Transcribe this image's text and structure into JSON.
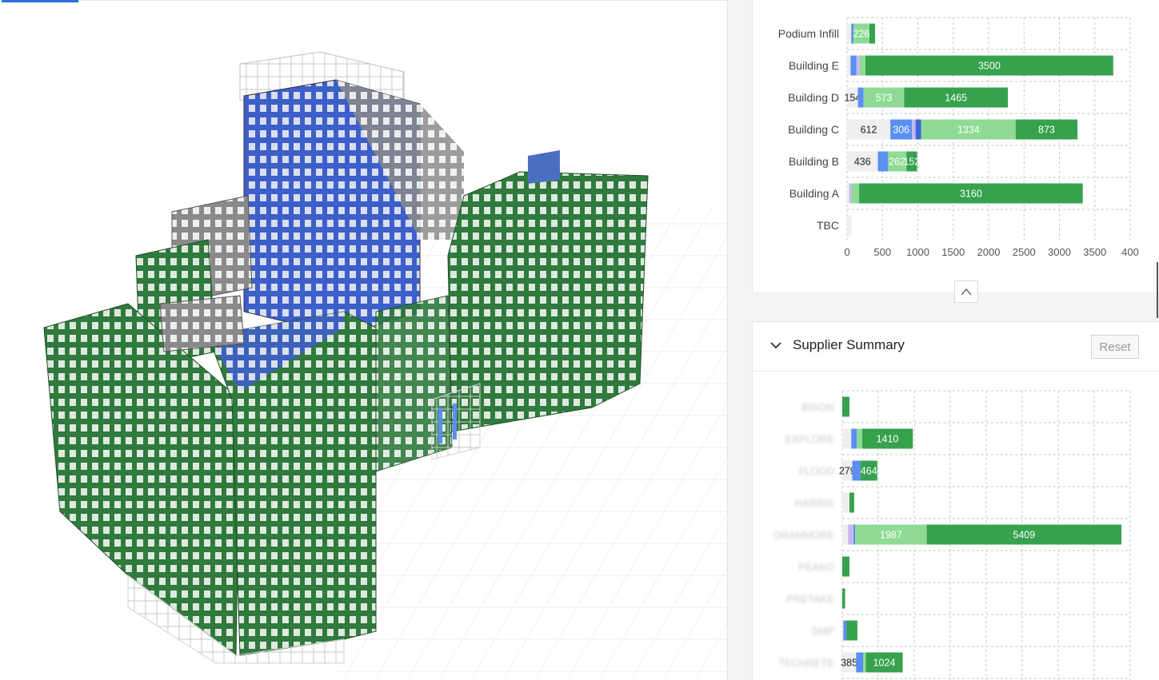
{
  "viewer": {
    "active_tab_indicator": "model-view"
  },
  "colors": {
    "gray": "#efefef",
    "blue": "#5b8ff2",
    "dark_blue": "#3f68d6",
    "lavender": "#c8b8f2",
    "light_green": "#8fdb95",
    "green": "#36a24e",
    "grid": "#c8c8c8"
  },
  "building_chart": {
    "type": "bar",
    "orientation": "horizontal",
    "stacked": true,
    "xlim": [
      0,
      4000
    ],
    "ticks": [
      "0",
      "500",
      "1000",
      "1500",
      "2000",
      "2500",
      "3000",
      "3500",
      "400"
    ],
    "categories": [
      "Podium Infill",
      "Building E",
      "Building D",
      "Building C",
      "Building B",
      "Building A",
      "TBC"
    ],
    "rows": [
      {
        "label": "Podium Infill",
        "segments": [
          {
            "color": "gray",
            "value": 60,
            "label": ""
          },
          {
            "color": "blue",
            "value": 30,
            "label": ""
          },
          {
            "color": "light_green",
            "value": 226,
            "label": "226"
          },
          {
            "color": "green",
            "value": 80,
            "label": ""
          }
        ]
      },
      {
        "label": "Building E",
        "segments": [
          {
            "color": "gray",
            "value": 50,
            "label": ""
          },
          {
            "color": "blue",
            "value": 80,
            "label": ""
          },
          {
            "color": "lavender",
            "value": 50,
            "label": ""
          },
          {
            "color": "light_green",
            "value": 80,
            "label": ""
          },
          {
            "color": "green",
            "value": 3500,
            "label": "3500"
          }
        ]
      },
      {
        "label": "Building D",
        "segments": [
          {
            "color": "gray",
            "value": 154,
            "label": "154"
          },
          {
            "color": "blue",
            "value": 80,
            "label": ""
          },
          {
            "color": "light_green",
            "value": 573,
            "label": "573"
          },
          {
            "color": "green",
            "value": 1465,
            "label": "1465"
          }
        ]
      },
      {
        "label": "Building C",
        "segments": [
          {
            "color": "gray",
            "value": 612,
            "label": "612"
          },
          {
            "color": "blue",
            "value": 306,
            "label": "306"
          },
          {
            "color": "lavender",
            "value": 50,
            "label": ""
          },
          {
            "color": "dark_blue",
            "value": 80,
            "label": ""
          },
          {
            "color": "light_green",
            "value": 1334,
            "label": "1334"
          },
          {
            "color": "green",
            "value": 873,
            "label": "873"
          }
        ]
      },
      {
        "label": "Building B",
        "segments": [
          {
            "color": "gray",
            "value": 436,
            "label": "436"
          },
          {
            "color": "blue",
            "value": 140,
            "label": ""
          },
          {
            "color": "light_green",
            "value": 262,
            "label": "262"
          },
          {
            "color": "green",
            "value": 152,
            "label": "152"
          }
        ]
      },
      {
        "label": "Building A",
        "segments": [
          {
            "color": "gray",
            "value": 30,
            "label": ""
          },
          {
            "color": "lavender",
            "value": 30,
            "label": ""
          },
          {
            "color": "light_green",
            "value": 110,
            "label": ""
          },
          {
            "color": "green",
            "value": 3160,
            "label": "3160"
          }
        ]
      },
      {
        "label": "TBC",
        "segments": [
          {
            "color": "gray",
            "value": 60,
            "label": ""
          }
        ]
      }
    ]
  },
  "supplier_summary": {
    "title": "Supplier Summary",
    "reset_label": "Reset",
    "chart": {
      "type": "bar",
      "orientation": "horizontal",
      "stacked": true,
      "xlim": [
        0,
        8000
      ],
      "categories": [
        "BISON",
        "EXPLORE",
        "FLOOD",
        "HARRIS",
        "ORANMORE",
        "PEAKO",
        "PRETAKE",
        "SMP",
        "TECHRETE"
      ],
      "rows": [
        {
          "label": "BISON",
          "segments": [
            {
              "color": "green",
              "value": 200,
              "label": ""
            }
          ]
        },
        {
          "label": "EXPLORE",
          "segments": [
            {
              "color": "gray",
              "value": 250,
              "label": ""
            },
            {
              "color": "blue",
              "value": 150,
              "label": ""
            },
            {
              "color": "light_green",
              "value": 150,
              "label": ""
            },
            {
              "color": "green",
              "value": 1410,
              "label": "1410"
            }
          ]
        },
        {
          "label": "FLOOD",
          "segments": [
            {
              "color": "gray",
              "value": 279,
              "label": "279"
            },
            {
              "color": "blue",
              "value": 230,
              "label": ""
            },
            {
              "color": "light_green",
              "value": 0,
              "label": ""
            },
            {
              "color": "green",
              "value": 464,
              "label": "464"
            }
          ]
        },
        {
          "label": "HARRIS",
          "segments": [
            {
              "color": "gray",
              "value": 200,
              "label": ""
            },
            {
              "color": "green",
              "value": 130,
              "label": ""
            }
          ]
        },
        {
          "label": "ORANMORE",
          "segments": [
            {
              "color": "gray",
              "value": 160,
              "label": ""
            },
            {
              "color": "lavender",
              "value": 150,
              "label": ""
            },
            {
              "color": "blue",
              "value": 50,
              "label": ""
            },
            {
              "color": "light_green",
              "value": 1987,
              "label": "1987"
            },
            {
              "color": "green",
              "value": 5409,
              "label": "5409"
            }
          ]
        },
        {
          "label": "PEAKO",
          "segments": [
            {
              "color": "green",
              "value": 200,
              "label": ""
            }
          ]
        },
        {
          "label": "PRETAKE",
          "segments": [
            {
              "color": "green",
              "value": 80,
              "label": ""
            }
          ]
        },
        {
          "label": "SMP",
          "segments": [
            {
              "color": "gray",
              "value": 30,
              "label": ""
            },
            {
              "color": "blue",
              "value": 90,
              "label": ""
            },
            {
              "color": "green",
              "value": 300,
              "label": ""
            }
          ]
        },
        {
          "label": "TECHRETE",
          "segments": [
            {
              "color": "gray",
              "value": 385,
              "label": "385"
            },
            {
              "color": "blue",
              "value": 200,
              "label": ""
            },
            {
              "color": "light_green",
              "value": 70,
              "label": ""
            },
            {
              "color": "green",
              "value": 1024,
              "label": "1024"
            }
          ]
        }
      ]
    }
  },
  "icons": {
    "collapse": "chevron-up-icon",
    "expand": "chevron-down-icon"
  }
}
